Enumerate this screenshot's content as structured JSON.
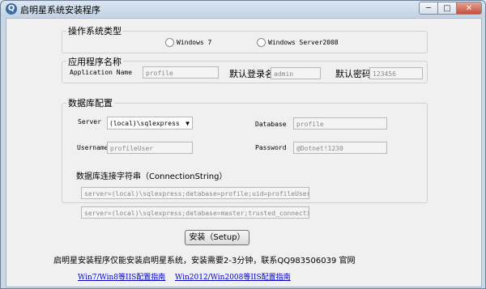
{
  "window": {
    "title": "启明星系统安装程序",
    "icon": "app-logo-icon",
    "min": "─",
    "max": "□",
    "close": "✕"
  },
  "os": {
    "group_label": "操作系统类型",
    "options": [
      "Windows 7",
      "Windows Server2008"
    ]
  },
  "app": {
    "group_label": "应用程序名称",
    "app_name_label": "Application Name",
    "app_name_value": "profile",
    "login_label": "默认登录名",
    "login_value": "admin",
    "password_label": "默认密码",
    "password_value": "123456"
  },
  "db": {
    "group_label": "数据库配置",
    "server_label": "Server",
    "server_value": "(local)\\sqlexpress",
    "database_label": "Database",
    "database_value": "profile",
    "username_label": "Username",
    "username_value": "profileUser",
    "password_label": "Password",
    "password_value": "@Dotnet!1230",
    "conn_label": "数据库连接字符串（ConnectionString）",
    "conn1": "server=(local)\\sqlexpress;database=profile;uid=profileUser;pwd=",
    "conn2": "server=(local)\\sqlexpress;database=master;trusted_connection=y"
  },
  "install_button": "安装（Setup）",
  "notice": "启明星安装程序仅能安装启明星系统，安装需要2-3分钟，联系QQ983506039 官网",
  "links": [
    "Win7/Win8等IIS配置指南",
    "Win2012/Win2008等IIS配置指南"
  ]
}
